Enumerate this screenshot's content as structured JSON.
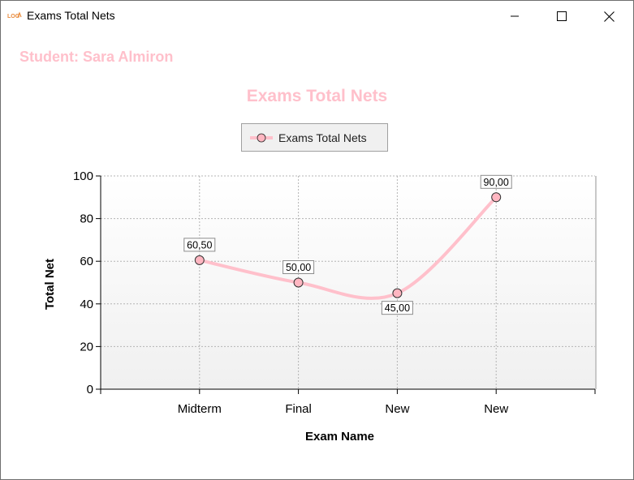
{
  "window": {
    "title": "Exams Total Nets",
    "icons": {
      "app": "app-logo-icon",
      "minimize": "minimize-icon",
      "maximize": "maximize-icon",
      "close": "close-icon"
    }
  },
  "student_label": "Student: Sara Almiron",
  "colors": {
    "accent": "#ffc0cb",
    "marker_fill": "#ffb6c1",
    "plot_bg_top": "#ffffff",
    "plot_bg_bottom": "#f0f0f0"
  },
  "chart_data": {
    "type": "line",
    "title": "Exams Total Nets",
    "xlabel": "Exam Name",
    "ylabel": "Total Net",
    "categories": [
      "Midterm",
      "Final",
      "New",
      "New"
    ],
    "series": [
      {
        "name": "Exams Total Nets",
        "values": [
          60.5,
          50,
          45,
          90
        ],
        "labels": [
          "60,50",
          "50,00",
          "45,00",
          "90,00"
        ]
      }
    ],
    "ylim": [
      0,
      100
    ],
    "yticks": [
      "0",
      "20",
      "40",
      "60",
      "80",
      "100"
    ],
    "grid": true,
    "legend": "top-center",
    "smooth": true
  }
}
